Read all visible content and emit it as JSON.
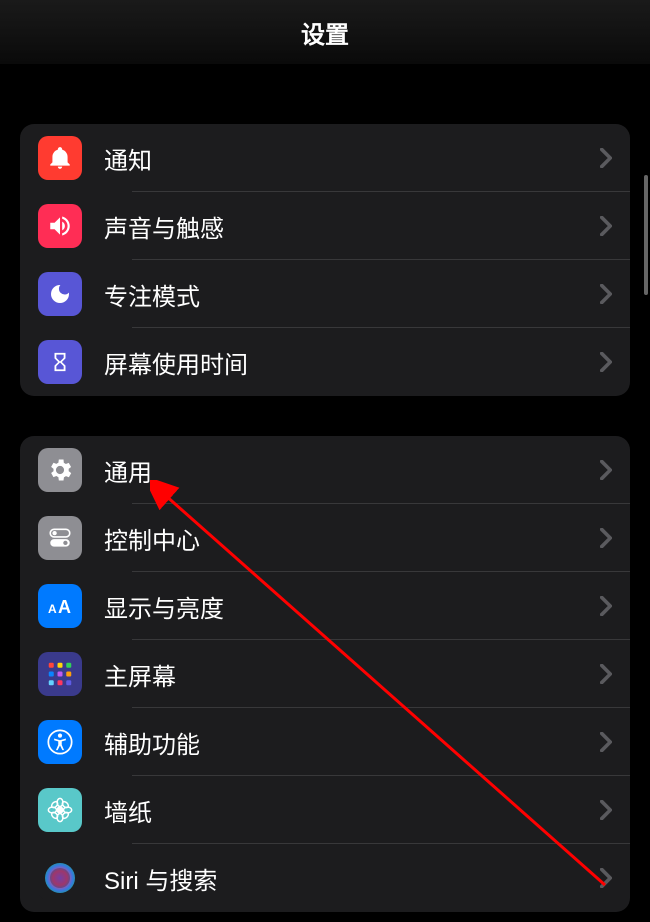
{
  "header": {
    "title": "设置"
  },
  "groups": [
    {
      "rows": [
        {
          "id": "notifications",
          "label": "通知",
          "icon": "bell-icon",
          "bgClass": "icon-notifications"
        },
        {
          "id": "sounds",
          "label": "声音与触感",
          "icon": "speaker-icon",
          "bgClass": "icon-sounds"
        },
        {
          "id": "focus",
          "label": "专注模式",
          "icon": "moon-icon",
          "bgClass": "icon-focus"
        },
        {
          "id": "screentime",
          "label": "屏幕使用时间",
          "icon": "hourglass-icon",
          "bgClass": "icon-screentime"
        }
      ]
    },
    {
      "rows": [
        {
          "id": "general",
          "label": "通用",
          "icon": "gear-icon",
          "bgClass": "icon-general"
        },
        {
          "id": "controlcenter",
          "label": "控制中心",
          "icon": "toggle-icon",
          "bgClass": "icon-controlcenter"
        },
        {
          "id": "display",
          "label": "显示与亮度",
          "icon": "textsize-icon",
          "bgClass": "icon-display"
        },
        {
          "id": "homescreen",
          "label": "主屏幕",
          "icon": "grid-icon",
          "bgClass": "icon-homescreen"
        },
        {
          "id": "accessibility",
          "label": "辅助功能",
          "icon": "accessibility-icon",
          "bgClass": "icon-accessibility"
        },
        {
          "id": "wallpaper",
          "label": "墙纸",
          "icon": "flower-icon",
          "bgClass": "icon-wallpaper"
        },
        {
          "id": "siri",
          "label": "Siri 与搜索",
          "icon": "siri-icon",
          "bgClass": "icon-siri"
        }
      ]
    }
  ],
  "annotation": {
    "target": "general",
    "color": "#ff0000"
  }
}
